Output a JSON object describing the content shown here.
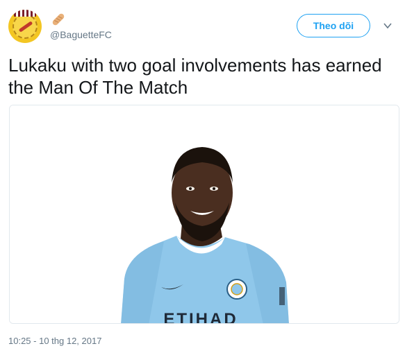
{
  "tweet": {
    "handle": "@BaguetteFC",
    "follow_label": "Theo dõi",
    "text": "Lukaku with two goal involvements has earned the Man Of The Match",
    "timestamp": "10:25 - 10 thg 12, 2017",
    "shirt_sponsor_text": "ETIHAD"
  },
  "icons": {
    "avatar": "baguette-fc-logo",
    "badge": "baguette-emoji-icon",
    "menu": "chevron-down-icon"
  },
  "colors": {
    "accent": "#1da1f2",
    "text": "#14171a",
    "muted": "#657786",
    "shirt": "#8fc7ea"
  }
}
